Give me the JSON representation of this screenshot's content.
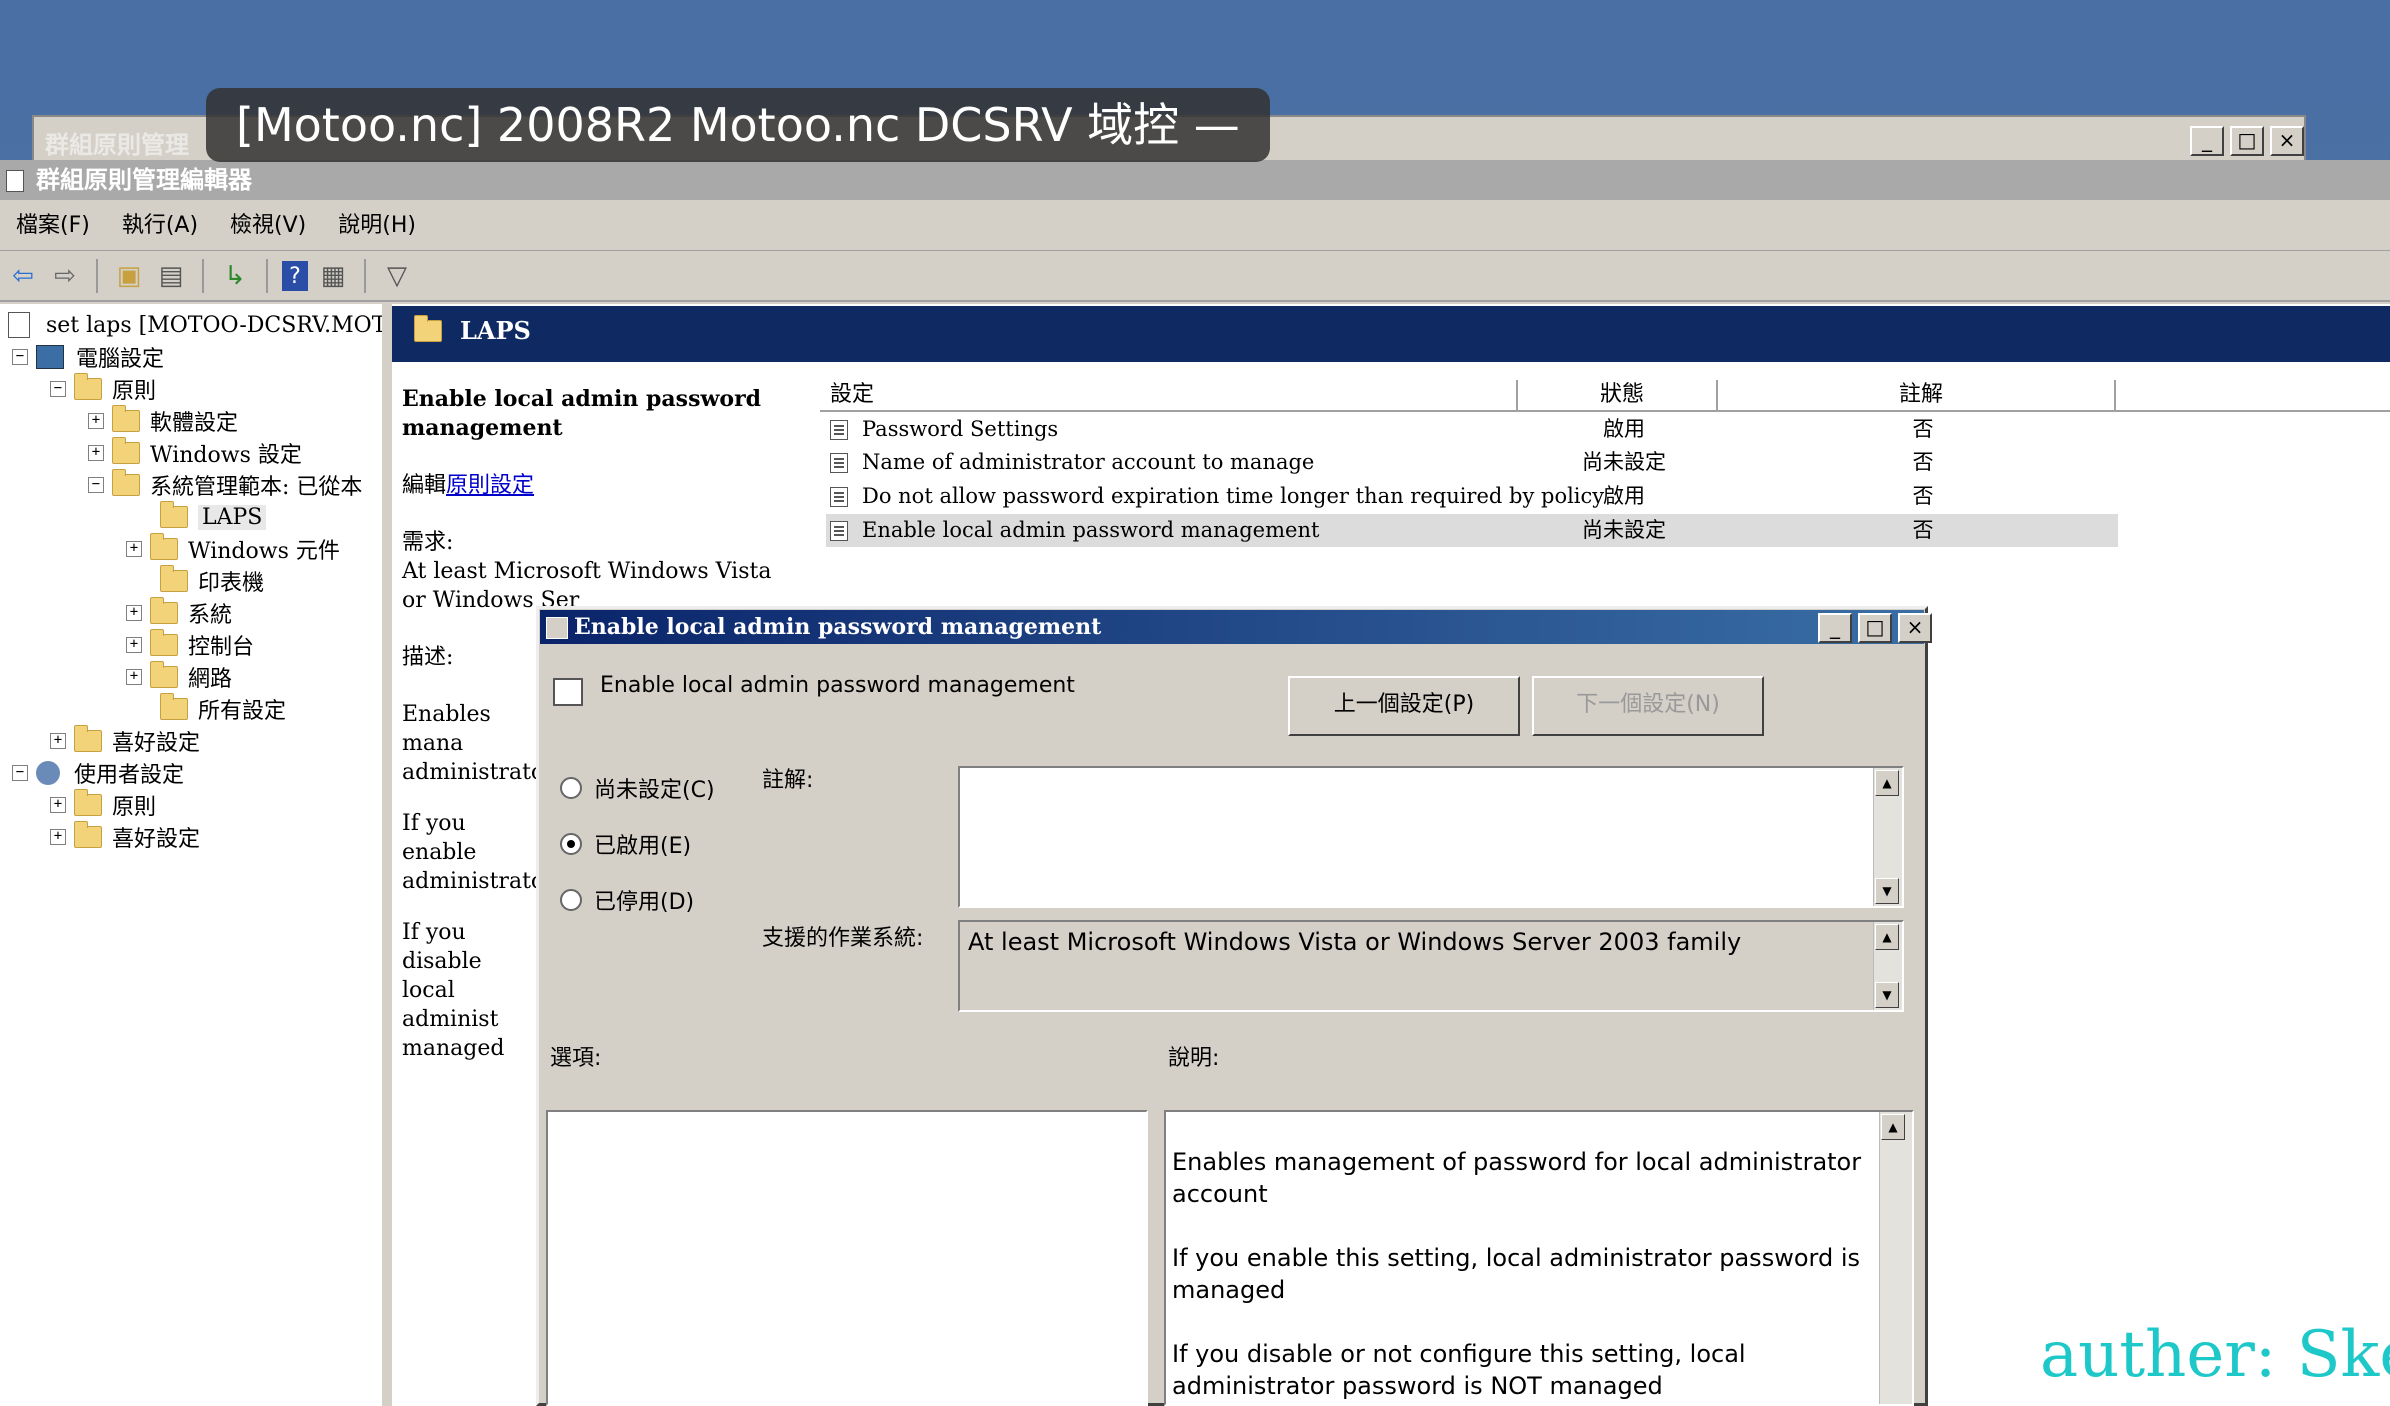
{
  "overlay_title": "[Motoo.nc] 2008R2 Motoo.nc DCSRV 域控 —",
  "back_window": {
    "title": "群組原則管理",
    "buttons": [
      "_",
      "□",
      "×"
    ]
  },
  "editor": {
    "title": "群組原則管理編輯器",
    "menu": [
      "檔案(F)",
      "執行(A)",
      "檢視(V)",
      "說明(H)"
    ],
    "toolbar_icons": [
      "back-icon",
      "forward-icon",
      "up-folder-icon",
      "show-hide-tree-icon",
      "export-icon",
      "help-icon",
      "properties-icon",
      "filter-icon"
    ]
  },
  "tree": [
    {
      "label": "set laps [MOTOO-DCSRV.MOTOO",
      "expander": "",
      "icon": "gpo-icon"
    },
    {
      "label": "電腦設定",
      "expander": "−",
      "icon": "computer-icon"
    },
    {
      "label": "原則",
      "expander": "−",
      "icon": "folder-icon"
    },
    {
      "label": "軟體設定",
      "expander": "+",
      "icon": "folder-icon"
    },
    {
      "label": "Windows 設定",
      "expander": "+",
      "icon": "folder-icon"
    },
    {
      "label": "系統管理範本: 已從本",
      "expander": "−",
      "icon": "folder-icon"
    },
    {
      "label": "LAPS",
      "expander": "",
      "icon": "folder-icon"
    },
    {
      "label": "Windows 元件",
      "expander": "+",
      "icon": "folder-icon"
    },
    {
      "label": "印表機",
      "expander": "",
      "icon": "folder-icon"
    },
    {
      "label": "系統",
      "expander": "+",
      "icon": "folder-icon"
    },
    {
      "label": "控制台",
      "expander": "+",
      "icon": "folder-icon"
    },
    {
      "label": "網路",
      "expander": "+",
      "icon": "folder-icon"
    },
    {
      "label": "所有設定",
      "expander": "",
      "icon": "all-settings-icon"
    },
    {
      "label": "喜好設定",
      "expander": "+",
      "icon": "folder-icon"
    },
    {
      "label": "使用者設定",
      "expander": "−",
      "icon": "user-icon"
    },
    {
      "label": "原則",
      "expander": "+",
      "icon": "folder-icon"
    },
    {
      "label": "喜好設定",
      "expander": "+",
      "icon": "folder-icon"
    }
  ],
  "right_pane": {
    "header": "LAPS",
    "description": {
      "heading": "Enable local admin password management",
      "edit_prefix": "編輯",
      "edit_link": "原則設定",
      "requirement_label": "需求:",
      "requirement_text": "At least Microsoft Windows Vista or Windows Ser",
      "description_label": "描述:",
      "p1": "Enables mana administrator",
      "p2": "If you enable administrator",
      "p3": "If you disable local administ managed"
    },
    "columns": [
      "設定",
      "狀態",
      "註解"
    ],
    "rows": [
      {
        "name": "Password Settings",
        "state": "啟用",
        "comment": "否",
        "selected": false
      },
      {
        "name": "Name of administrator account to manage",
        "state": "尚未設定",
        "comment": "否",
        "selected": false
      },
      {
        "name": "Do not allow password expiration time longer than required by policy",
        "state": "啟用",
        "comment": "否",
        "selected": false
      },
      {
        "name": "Enable local admin password management",
        "state": "尚未設定",
        "comment": "否",
        "selected": true
      }
    ]
  },
  "dialog": {
    "title": "Enable local admin password management",
    "setting_name": "Enable local admin password management",
    "prev_button": "上一個設定(P)",
    "next_button": "下一個設定(N)",
    "radios": [
      {
        "label": "尚未設定(C)",
        "checked": false
      },
      {
        "label": "已啟用(E)",
        "checked": true
      },
      {
        "label": "已停用(D)",
        "checked": false
      }
    ],
    "comment_label": "註解:",
    "comment_value": "",
    "supported_label": "支援的作業系統:",
    "supported_value": "At least Microsoft Windows Vista or Windows Server 2003 family",
    "options_label": "選項:",
    "help_label": "說明:",
    "help_p1": "Enables management of password for local administrator account",
    "help_p2": "If you enable this setting, local administrator password is managed",
    "help_p3": "If you disable or not configure this setting, local administrator password is NOT managed"
  },
  "watermark": "auther: Ske",
  "colors": {
    "desktop": "#4a6fa4",
    "header_navy": "#0f2a63",
    "watermark": "#1ec8c8",
    "link": "#0000cc"
  }
}
